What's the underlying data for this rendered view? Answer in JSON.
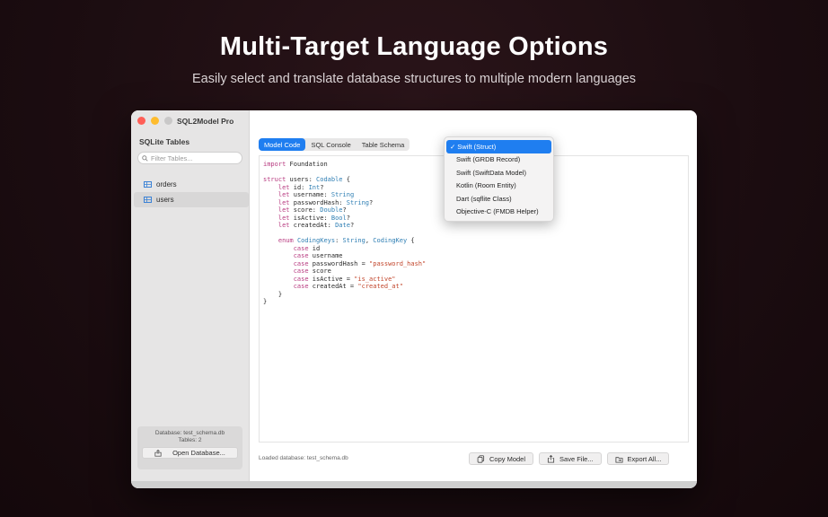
{
  "hero": {
    "title": "Multi-Target Language Options",
    "subtitle": "Easily select and translate database structures to multiple modern languages"
  },
  "window": {
    "title": "SQL2Model Pro"
  },
  "sidebar": {
    "heading": "SQLite Tables",
    "search_placeholder": "Filter Tables...",
    "tables": [
      {
        "name": "orders",
        "selected": false
      },
      {
        "name": "users",
        "selected": true
      }
    ],
    "database_label": "Database: test_schema.db",
    "tables_count_label": "Tables: 2",
    "open_button": "Open Database..."
  },
  "tabs": [
    {
      "label": "Model Code",
      "active": true
    },
    {
      "label": "SQL Console",
      "active": false
    },
    {
      "label": "Table Schema",
      "active": false
    }
  ],
  "language_dropdown": {
    "selected": "Swift (Struct)",
    "options": [
      "Swift (Struct)",
      "Swift (GRDB Record)",
      "Swift (SwiftData Model)",
      "Kotlin (Room Entity)",
      "Dart (sqflite Class)",
      "Objective-C (FMDB Helper)"
    ]
  },
  "status": {
    "text": "Loaded database: test_schema.db"
  },
  "actions": {
    "copy": "Copy Model",
    "save": "Save File...",
    "export": "Export All..."
  },
  "icons": {
    "table": "table-icon",
    "search": "search-icon",
    "open": "open-database-icon",
    "copy": "copy-icon",
    "save": "share-save-icon",
    "export": "export-icon"
  },
  "colors": {
    "accent": "#1f7ef0",
    "keyword": "#b83b80",
    "type": "#2f7fb4",
    "string": "#c2462c"
  }
}
